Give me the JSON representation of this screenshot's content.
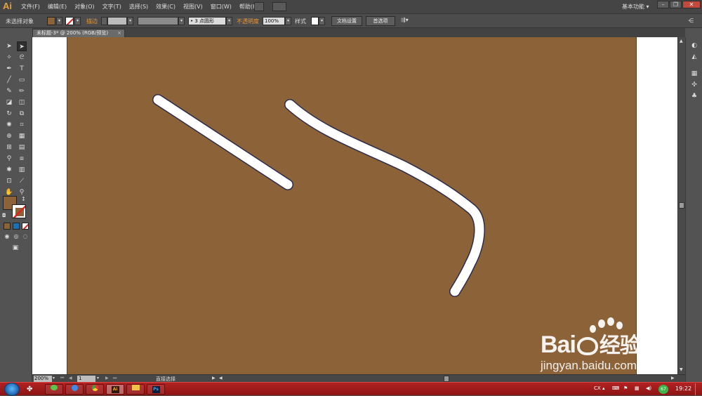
{
  "app": {
    "logo": "Ai",
    "workspace": "基本功能",
    "workspace_arrow": "▾"
  },
  "menu": [
    "文件(F)",
    "编辑(E)",
    "对象(O)",
    "文字(T)",
    "选择(S)",
    "效果(C)",
    "视图(V)",
    "窗口(W)",
    "帮助(H)"
  ],
  "window_controls": {
    "minimize": "–",
    "restore": "❐",
    "close": "✕"
  },
  "control_bar": {
    "selection_status": "未选择对象",
    "fill_color": "#8c6239",
    "stroke_label": "描边",
    "brush_value": "3 点圆形",
    "opacity_label": "不透明度",
    "opacity_value": "100%",
    "style_label": "样式",
    "doc_setup_button": "文档设置",
    "preferences_button": "首选项"
  },
  "document_tab": {
    "title": "未标题-3* @ 200% (RGB/预览)",
    "close": "×"
  },
  "canvas": {
    "artboard_color": "#8c6239",
    "path_color": "#ffffff",
    "path_outline": "#2b2b4a"
  },
  "tool_fill_color": "#8c6239",
  "status_bar": {
    "zoom": "200%",
    "page": "1",
    "status_text": "直接选择"
  },
  "taskbar": {
    "clock": "19:22",
    "input_method": "CX",
    "battery_badge": "67",
    "apps": [
      {
        "name": "wechat",
        "label": ""
      },
      {
        "name": "browser",
        "label": ""
      },
      {
        "name": "chrome",
        "label": ""
      },
      {
        "name": "illustrator",
        "label": "Ai"
      },
      {
        "name": "explorer",
        "label": ""
      },
      {
        "name": "photoshop",
        "label": "Ps"
      }
    ]
  },
  "watermark": {
    "brand": "Bai",
    "brand_suffix": "经验",
    "url": "jingyan.baidu.com"
  }
}
